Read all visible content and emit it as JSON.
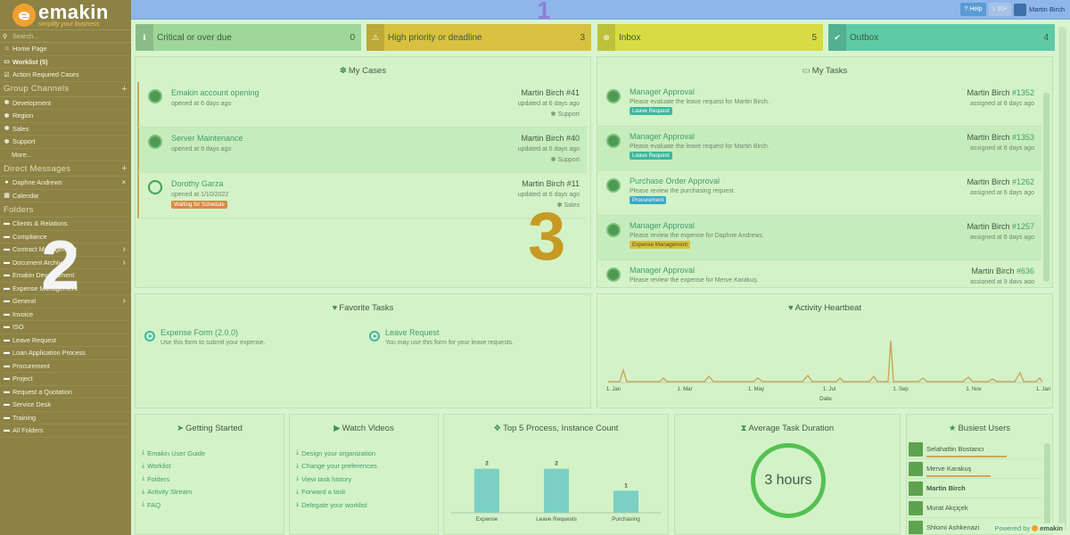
{
  "brand": {
    "name": "emakin",
    "tagline": "simplify your business"
  },
  "sidebar": {
    "search_placeholder": "Search...",
    "home": "Home Page",
    "worklist": "Worklist (5)",
    "action_required": "Action Required Cases",
    "group_channels_title": "Group Channels",
    "channels": [
      "Development",
      "Region",
      "Sales",
      "Support"
    ],
    "more": "More...",
    "direct_messages_title": "Direct Messages",
    "dm_user": "Daphne Andrews",
    "calendar": "Calendar",
    "folders_title": "Folders",
    "folders": [
      "Clients & Relations",
      "Compliance",
      "Contract Management",
      "Document Archive",
      "Emakin Development",
      "Expense Management",
      "General",
      "Invoice",
      "ISO",
      "Leave Request",
      "Loan Application Process",
      "Procurement",
      "Project",
      "Request a Quotation",
      "Service Desk",
      "Training",
      "All Folders"
    ]
  },
  "topbar": {
    "help": "Help",
    "notifications": "10+",
    "user": "Martin Birch"
  },
  "callouts": {
    "one": "1",
    "two": "2",
    "three": "3"
  },
  "status": [
    {
      "label": "Critical or over due",
      "count": "0",
      "color": "#9fd69a"
    },
    {
      "label": "High priority or deadline",
      "count": "3",
      "color": "#d8c140"
    },
    {
      "label": "Inbox",
      "count": "5",
      "color": "#d7dc44"
    },
    {
      "label": "Outbox",
      "count": "4",
      "color": "#5fc9a6"
    }
  ],
  "my_cases": {
    "title": "My Cases",
    "items": [
      {
        "title": "Emakin account opening",
        "sub": "opened at 6 days ago",
        "owner": "Martin Birch",
        "num": "#41",
        "updated": "updated at 6 days ago",
        "cat": "Support"
      },
      {
        "title": "Server Maintenance",
        "sub": "opened at 9 days ago",
        "owner": "Martin Birch",
        "num": "#40",
        "updated": "updated at 6 days ago",
        "cat": "Support"
      },
      {
        "title": "Dorothy Garza",
        "sub": "opened at 1/10/2022",
        "owner": "Martin Birch",
        "num": "#11",
        "updated": "updated at 6 days ago",
        "cat": "Sales",
        "badge": "Waiting for Schedule"
      }
    ]
  },
  "my_tasks": {
    "title": "My Tasks",
    "items": [
      {
        "title": "Manager Approval",
        "desc": "Please evaluate the leave request for Martin Birch.",
        "badge": "Leave Request",
        "owner": "Martin Birch",
        "num": "#1352",
        "assigned": "assigned at 6 days ago"
      },
      {
        "title": "Manager Approval",
        "desc": "Please evaluate the leave request for Martin Birch.",
        "badge": "Leave Request",
        "owner": "Martin Birch",
        "num": "#1353",
        "assigned": "assigned at 6 days ago"
      },
      {
        "title": "Purchase Order Approval",
        "desc": "Please review the purchasing request.",
        "badge": "Procurement",
        "owner": "Martin Birch",
        "num": "#1262",
        "assigned": "assigned at 6 days ago"
      },
      {
        "title": "Manager Approval",
        "desc": "Please review the expense for Daphne Andrews.",
        "badge": "Expense Management",
        "owner": "Martin Birch",
        "num": "#1257",
        "assigned": "assigned at 6 days ago"
      },
      {
        "title": "Manager Approval",
        "desc": "Please review the expense for Merve Karakuş.",
        "owner": "Martin Birch",
        "num": "#636",
        "assigned": "assigned at 9 days ago"
      }
    ]
  },
  "favorites": {
    "title": "Favorite Tasks",
    "items": [
      {
        "title": "Expense Form",
        "version": "(2.0.0)",
        "desc": "Use this form to submit your expense."
      },
      {
        "title": "Leave Request",
        "version": "",
        "desc": "You may use this form for your leave requests."
      }
    ]
  },
  "heartbeat": {
    "title": "Activity Heartbeat",
    "xlabel": "Date",
    "ticks": [
      "1. Jan",
      "1. Mar",
      "1. May",
      "1. Jul",
      "1. Sep",
      "1. Nov",
      "1. Jan"
    ]
  },
  "getting_started": {
    "title": "Getting Started",
    "links": [
      "Emakin User Guide",
      "Worklist",
      "Folders",
      "Activity Stream",
      "FAQ"
    ]
  },
  "watch_videos": {
    "title": "Watch Videos",
    "links": [
      "Design your organization",
      "Change your preferences",
      "View task history",
      "Forward a task",
      "Delegate your worklist"
    ]
  },
  "top5": {
    "title": "Top 5 Process, Instance Count"
  },
  "chart_data": {
    "type": "bar",
    "categories": [
      "Expense",
      "Leave Requests",
      "Purchasing"
    ],
    "values": [
      2,
      2,
      1
    ]
  },
  "avg_duration": {
    "title": "Average Task Duration",
    "value": "3 hours"
  },
  "busiest": {
    "title": "Busiest Users",
    "users": [
      {
        "name": "Selahattin Bostancı",
        "level": 0.9
      },
      {
        "name": "Merve Karakuş",
        "level": 0.72
      },
      {
        "name": "Martin Birch",
        "level": 0
      },
      {
        "name": "Murat Akçiçek",
        "level": 0
      },
      {
        "name": "Shlomi Ashkenazi",
        "level": 0
      }
    ]
  },
  "powered": "Powered by"
}
